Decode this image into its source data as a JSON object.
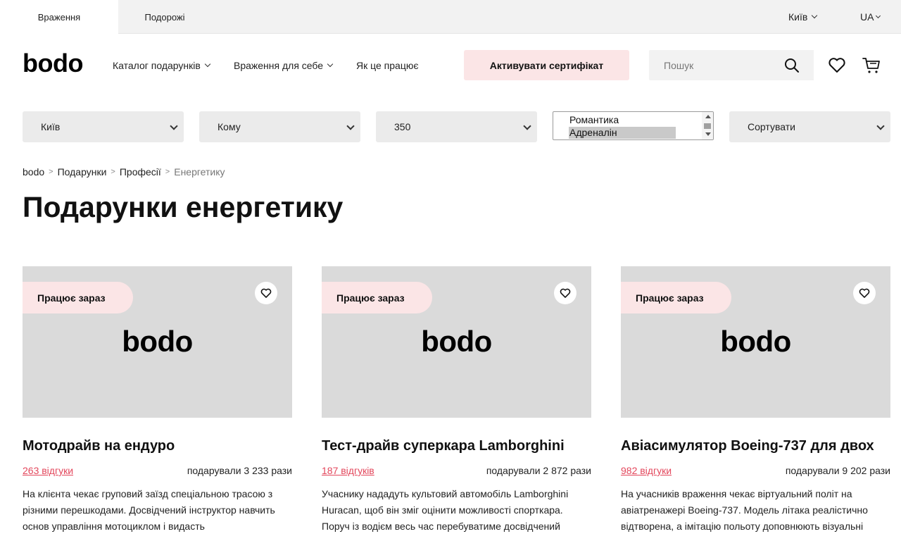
{
  "topbar": {
    "tabs": [
      {
        "label": "Враження"
      },
      {
        "label": "Подорожі"
      }
    ],
    "city": "Київ",
    "lang": "UA"
  },
  "header": {
    "logo": "bodo",
    "nav": [
      {
        "label": "Каталог подарунків"
      },
      {
        "label": "Враження для себе"
      },
      {
        "label": "Як це працює"
      }
    ],
    "activate_label": "Активувати сертифікат",
    "search_placeholder": "Пошук",
    "icons": [
      "search-icon",
      "heart-icon",
      "cart-icon"
    ]
  },
  "filters": {
    "city": "Київ",
    "whom": "Кому",
    "price": "350",
    "categories": [
      "Романтика",
      "Адреналін"
    ],
    "selected_category": "Адреналін",
    "sort": "Сортувати"
  },
  "breadcrumb": {
    "items": [
      "bodo",
      "Подарунки",
      "Професії"
    ],
    "current": "Енергетику"
  },
  "page_title": "Подарунки енергетику",
  "cards": [
    {
      "badge": "Працює зараз",
      "image_logo": "bodo",
      "title": "Мотодрайв на ендуро",
      "reviews": "263 відгуки",
      "gifted": "подарували 3 233 рази",
      "description": "На клієнта чекає груповий заїзд спеціальною трасою з різними перешкодами. Досвідчений інструктор навчить основ управління мотоциклом і видасть"
    },
    {
      "badge": "Працює зараз",
      "image_logo": "bodo",
      "title": "Тест-драйв суперкара Lamborghini",
      "reviews": "187 відгуків",
      "gifted": "подарували 2 872 рази",
      "description": "Учаснику нададуть культовий автомобіль Lamborghini Huracan, щоб він зміг оцінити можливості спорткара. Поруч із водієм весь час перебуватиме досвідчений"
    },
    {
      "badge": "Працює зараз",
      "image_logo": "bodo",
      "title": "Авіасимулятор Boeing-737 для двох",
      "reviews": "982 відгуки",
      "gifted": "подарували 9 202 рази",
      "description": "На учасників враження чекає віртуальний політ на авіатренажері Boeing-737. Модель літака реалістично відтворена, а імітацію польоту доповнюють візуальні"
    }
  ],
  "colors": {
    "accent_pink": "#fbe5e6",
    "link_red": "#e3475c",
    "placeholder_grey": "#dadada"
  }
}
